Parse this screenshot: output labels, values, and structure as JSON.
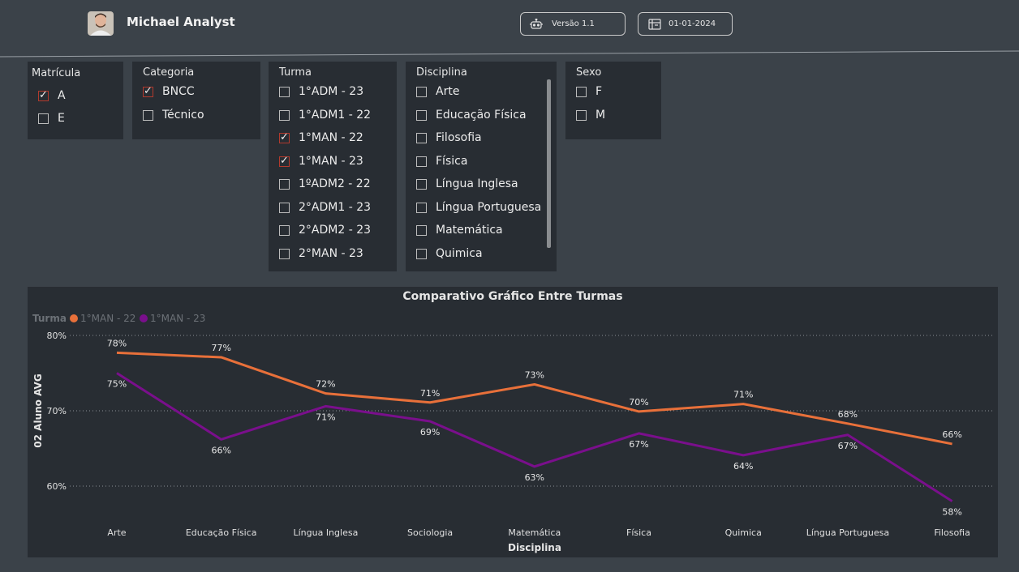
{
  "header": {
    "user_name": "Michael Analyst",
    "version_label": "Versão 1.1",
    "date_label": "01-01-2024"
  },
  "slicers": {
    "matricula": {
      "title": "Matrícula",
      "options": [
        {
          "label": "A",
          "checked": true
        },
        {
          "label": "E",
          "checked": false
        }
      ]
    },
    "categoria": {
      "title": "Categoria",
      "options": [
        {
          "label": "BNCC",
          "checked": true
        },
        {
          "label": "Técnico",
          "checked": false
        }
      ]
    },
    "turma": {
      "title": "Turma",
      "options": [
        {
          "label": "1°ADM - 23",
          "checked": false
        },
        {
          "label": "1°ADM1 - 22",
          "checked": false
        },
        {
          "label": "1°MAN - 22",
          "checked": true
        },
        {
          "label": "1°MAN - 23",
          "checked": true
        },
        {
          "label": "1ºADM2 - 22",
          "checked": false
        },
        {
          "label": "2°ADM1 - 23",
          "checked": false
        },
        {
          "label": "2°ADM2 - 23",
          "checked": false
        },
        {
          "label": "2°MAN - 23",
          "checked": false
        }
      ]
    },
    "disciplina": {
      "title": "Disciplina",
      "options": [
        {
          "label": "Arte",
          "checked": false
        },
        {
          "label": "Educação Física",
          "checked": false
        },
        {
          "label": "Filosofia",
          "checked": false
        },
        {
          "label": "Física",
          "checked": false
        },
        {
          "label": "Língua Inglesa",
          "checked": false
        },
        {
          "label": "Língua Portuguesa",
          "checked": false
        },
        {
          "label": "Matemática",
          "checked": false
        },
        {
          "label": "Quimica",
          "checked": false
        }
      ]
    },
    "sexo": {
      "title": "Sexo",
      "options": [
        {
          "label": "F",
          "checked": false
        },
        {
          "label": "M",
          "checked": false
        }
      ]
    }
  },
  "chart_data": {
    "type": "line",
    "title": "Comparativo Gráfico Entre Turmas",
    "legend_title": "Turma",
    "legend_position": "top-left",
    "xlabel": "Disciplina",
    "ylabel": "02 Aluno AVG",
    "ylim": [
      58,
      80
    ],
    "yticks": [
      60,
      70,
      80
    ],
    "ytick_labels": [
      "60%",
      "70%",
      "80%"
    ],
    "grid": "dotted horizontal",
    "categories": [
      "Arte",
      "Educação Física",
      "Língua Inglesa",
      "Sociologia",
      "Matemática",
      "Física",
      "Quimica",
      "Língua Portuguesa",
      "Filosofia"
    ],
    "series": [
      {
        "name": "1°MAN - 22",
        "color": "#e8703a",
        "values": [
          77.7,
          77.1,
          72.3,
          71.1,
          73.5,
          69.9,
          70.9,
          68.3,
          65.6
        ],
        "labels": [
          "78%",
          "77%",
          "72%",
          "71%",
          "73%",
          "70%",
          "71%",
          "68%",
          "66%"
        ]
      },
      {
        "name": "1°MAN - 23",
        "color": "#7a0f8c",
        "values": [
          75.0,
          66.2,
          70.6,
          68.6,
          62.6,
          67.0,
          64.1,
          66.8,
          58.0
        ],
        "labels": [
          "75%",
          "66%",
          "71%",
          "69%",
          "63%",
          "67%",
          "64%",
          "67%",
          "58%"
        ]
      }
    ]
  }
}
